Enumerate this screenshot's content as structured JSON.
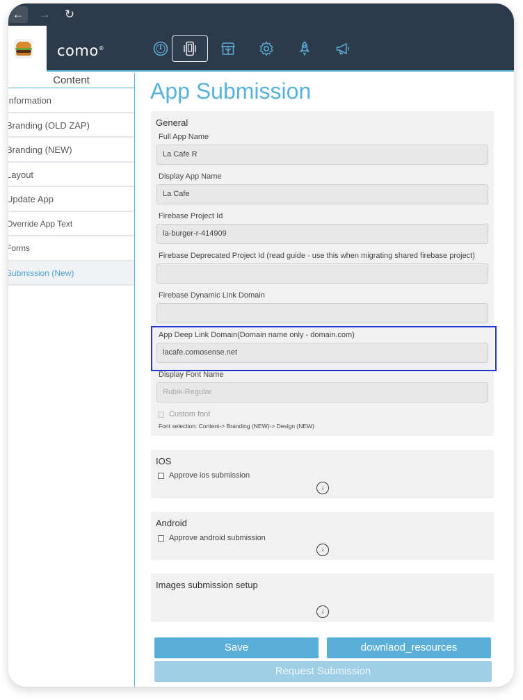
{
  "browser": {
    "back_icon": "arrow-left-icon",
    "forward_icon": "arrow-right-icon",
    "reload_icon": "reload-icon"
  },
  "header": {
    "logo_icon": "burger-logo-icon",
    "brand": "como",
    "brand_mark": "®",
    "nav_icons": [
      "dashboard-gauge-icon",
      "mobile-app-icon",
      "gift-store-icon",
      "settings-gear-icon",
      "rocket-icon",
      "megaphone-icon"
    ],
    "active_nav": "mobile-app-icon",
    "accent_color": "#5aaed6"
  },
  "sidebar": {
    "title": "Content",
    "items": [
      {
        "label": "Information"
      },
      {
        "label": "Branding (OLD ZAP)"
      },
      {
        "label": "Branding (NEW)"
      },
      {
        "label": "Layout"
      },
      {
        "label": "Update App"
      },
      {
        "label": "Override App Text"
      },
      {
        "label": "Forms"
      },
      {
        "label": "Submission (New)"
      }
    ],
    "active_item": "Submission (New)"
  },
  "main": {
    "title": "App Submission",
    "general": {
      "title": "General",
      "fields": [
        {
          "label": "Full App Name",
          "value": "La Cafe R"
        },
        {
          "label": "Display App Name",
          "value": "La Cafe"
        },
        {
          "label": "Firebase Project Id",
          "value": "la-burger-r-414909"
        },
        {
          "label": "Firebase Deprecated Project Id (read guide - use this when migrating shared firebase project)",
          "value": ""
        },
        {
          "label": "Firebase Dynamic Link Domain",
          "value": ""
        },
        {
          "label": "App Deep Link Domain(Domain name only - domain.com)",
          "value": "lacafe.comosense.net"
        },
        {
          "label": "Display Font Name",
          "placeholder": "Rubik-Regular"
        }
      ],
      "custom_font_label": "Custom font",
      "font_hint": "Font selection: Content-> Branding (NEW)-> Design (NEW)"
    },
    "ios": {
      "title": "IOS",
      "checkbox_label": "Approve ios submission",
      "expand_icon": "circle-arrow-down-icon"
    },
    "android": {
      "title": "Android",
      "checkbox_label": "Approve android submission",
      "expand_icon": "circle-arrow-down-icon"
    },
    "images": {
      "title": "Images submission setup",
      "expand_icon": "circle-arrow-down-icon"
    },
    "buttons": {
      "save": "Save",
      "download": "downlaod_resources",
      "request": "Request Submission"
    }
  }
}
